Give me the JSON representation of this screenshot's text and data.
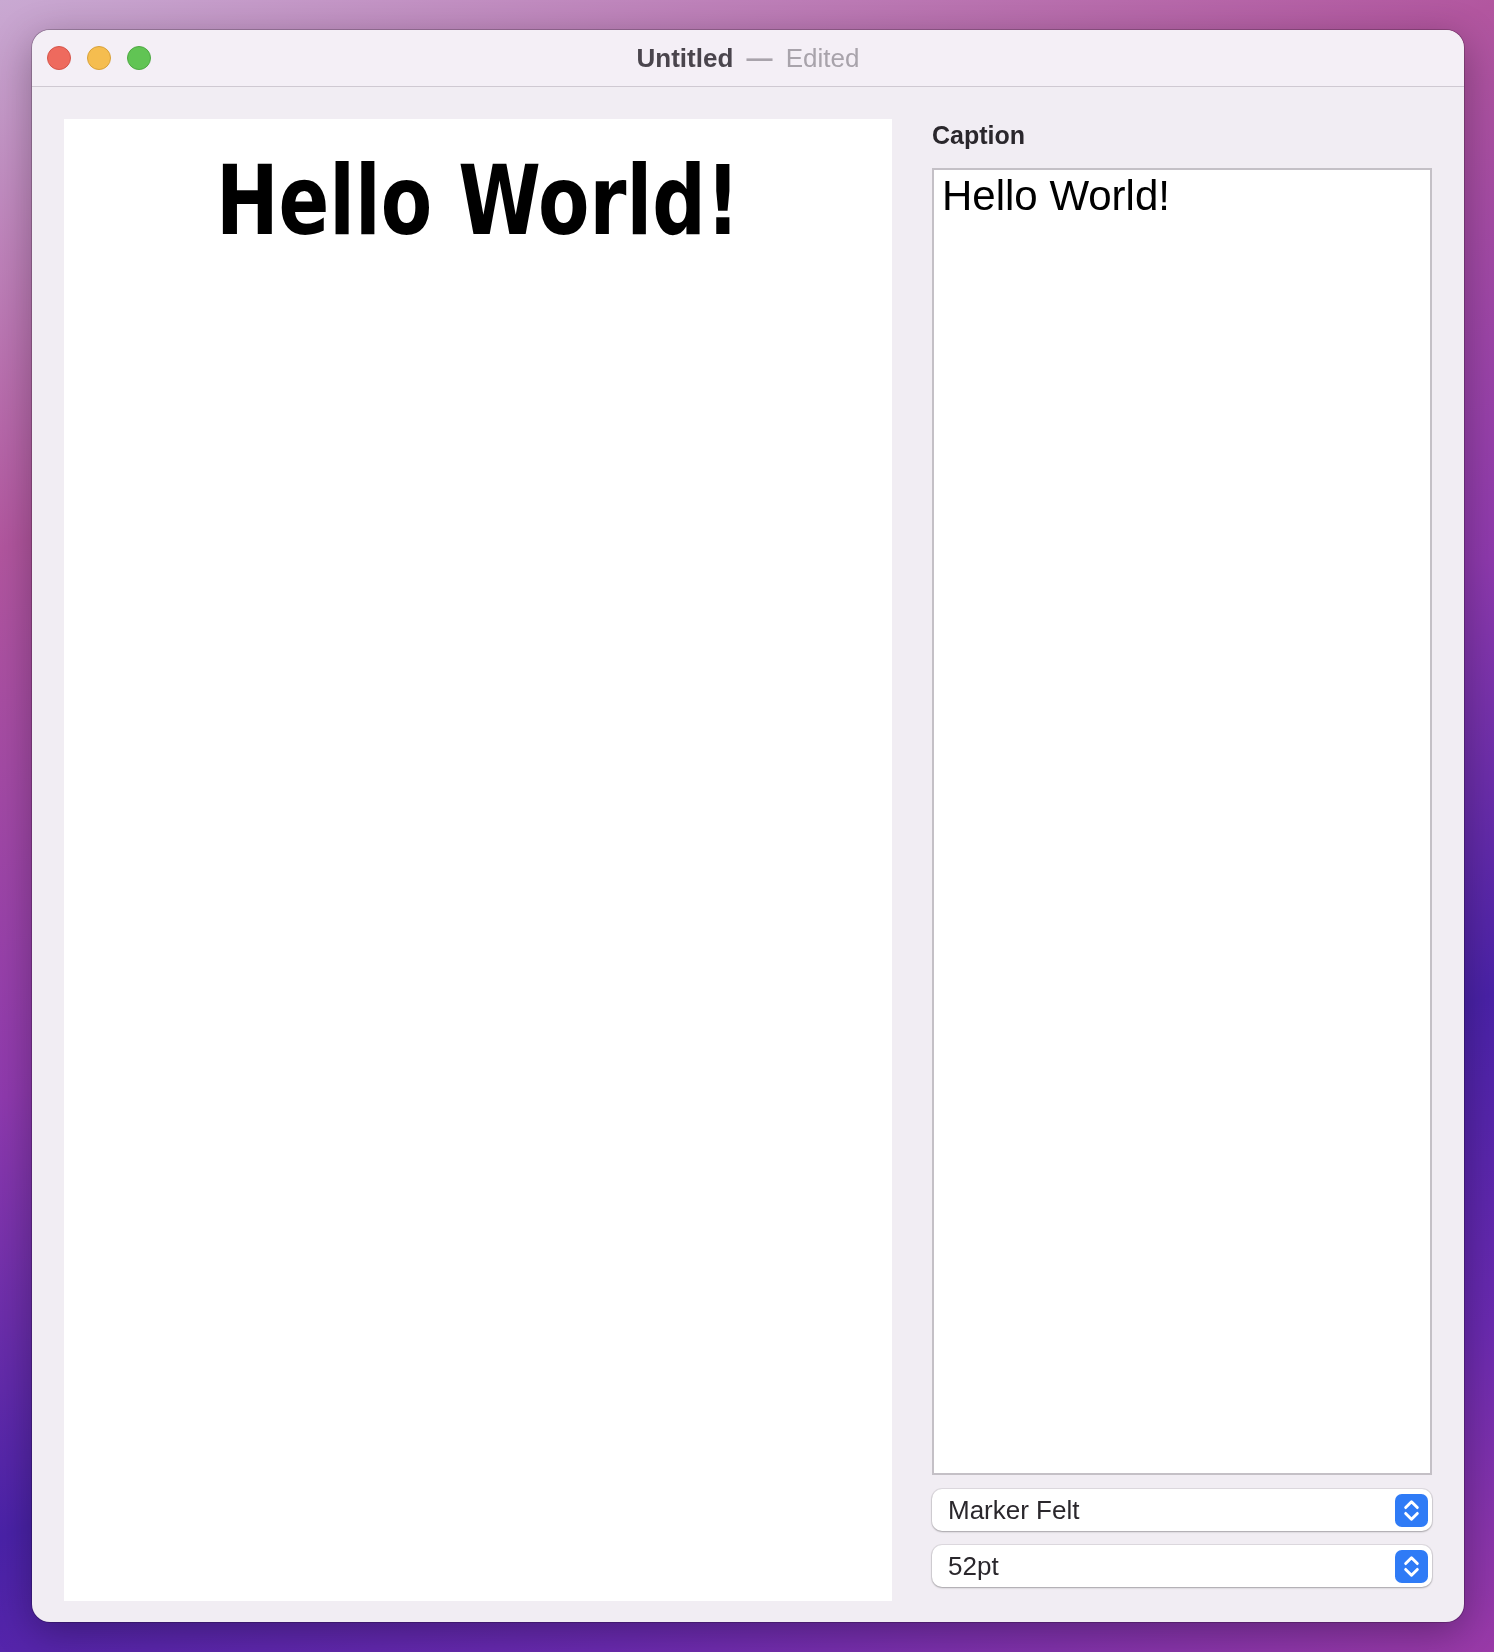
{
  "window": {
    "title": "Untitled",
    "separator": "—",
    "status": "Edited"
  },
  "preview": {
    "text": "Hello World!"
  },
  "caption": {
    "label": "Caption",
    "value": "Hello World!"
  },
  "popups": [
    {
      "value": "Marker Felt"
    },
    {
      "value": "52pt"
    }
  ]
}
